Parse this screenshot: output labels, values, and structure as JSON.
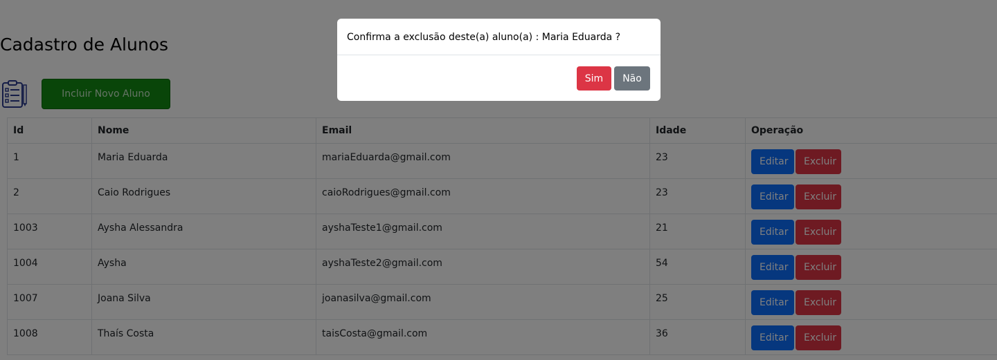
{
  "page": {
    "title": "Cadastro de Alunos",
    "icon": "clipboard-list-icon",
    "add_button_label": "Incluir Novo Aluno"
  },
  "table": {
    "headers": [
      "Id",
      "Nome",
      "Email",
      "Idade",
      "Operação"
    ],
    "rows": [
      {
        "id": "1",
        "nome": "Maria Eduarda",
        "email": "mariaEduarda@gmail.com",
        "idade": "23"
      },
      {
        "id": "2",
        "nome": "Caio Rodrigues",
        "email": "caioRodrigues@gmail.com",
        "idade": "23"
      },
      {
        "id": "1003",
        "nome": "Aysha Alessandra",
        "email": "ayshaTeste1@gmail.com",
        "idade": "21"
      },
      {
        "id": "1004",
        "nome": "Aysha",
        "email": "ayshaTeste2@gmail.com",
        "idade": "54"
      },
      {
        "id": "1007",
        "nome": "Joana Silva",
        "email": "joanasilva@gmail.com",
        "idade": "25"
      },
      {
        "id": "1008",
        "nome": "Thaís Costa",
        "email": "taisCosta@gmail.com",
        "idade": "36"
      }
    ],
    "edit_label": "Editar",
    "delete_label": "Excluir"
  },
  "modal": {
    "message": "Confirma a exclusão deste(a) aluno(a) : Maria Eduarda ?",
    "yes_label": "Sim",
    "no_label": "Não"
  },
  "colors": {
    "add_button": "#138a13",
    "edit_button": "#0d6efd",
    "delete_button": "#dc3545",
    "no_button": "#6c757d",
    "backdrop": "rgba(0,0,0,0.5)"
  }
}
